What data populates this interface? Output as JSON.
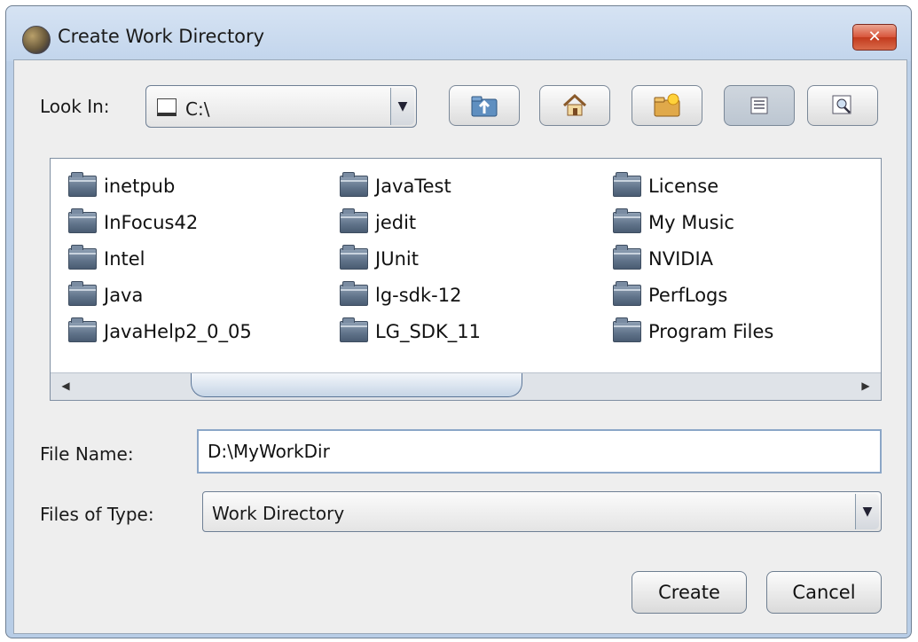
{
  "window": {
    "title": "Create Work Directory",
    "close_glyph": "✕"
  },
  "lookin": {
    "label": "Look In:",
    "value": "C:\\"
  },
  "toolbar": {
    "icons": [
      "up-folder-icon",
      "home-icon",
      "new-folder-icon",
      "list-view-icon",
      "details-view-icon"
    ]
  },
  "files": {
    "columns": [
      [
        "inetpub",
        "InFocus42",
        "Intel",
        "Java",
        "JavaHelp2_0_05"
      ],
      [
        "JavaTest",
        "jedit",
        "JUnit",
        "lg-sdk-12",
        "LG_SDK_11"
      ],
      [
        "License",
        "My Music",
        "NVIDIA",
        "PerfLogs",
        "Program Files"
      ]
    ]
  },
  "filename": {
    "label": "File Name:",
    "value": "D:\\MyWorkDir"
  },
  "filetype": {
    "label": "Files of Type:",
    "value": "Work Directory"
  },
  "buttons": {
    "create": "Create",
    "cancel": "Cancel"
  },
  "colors": {
    "titlebar": "#c2d5ec",
    "close_button": "#d8553a",
    "field_border": "#8ba6c7"
  }
}
